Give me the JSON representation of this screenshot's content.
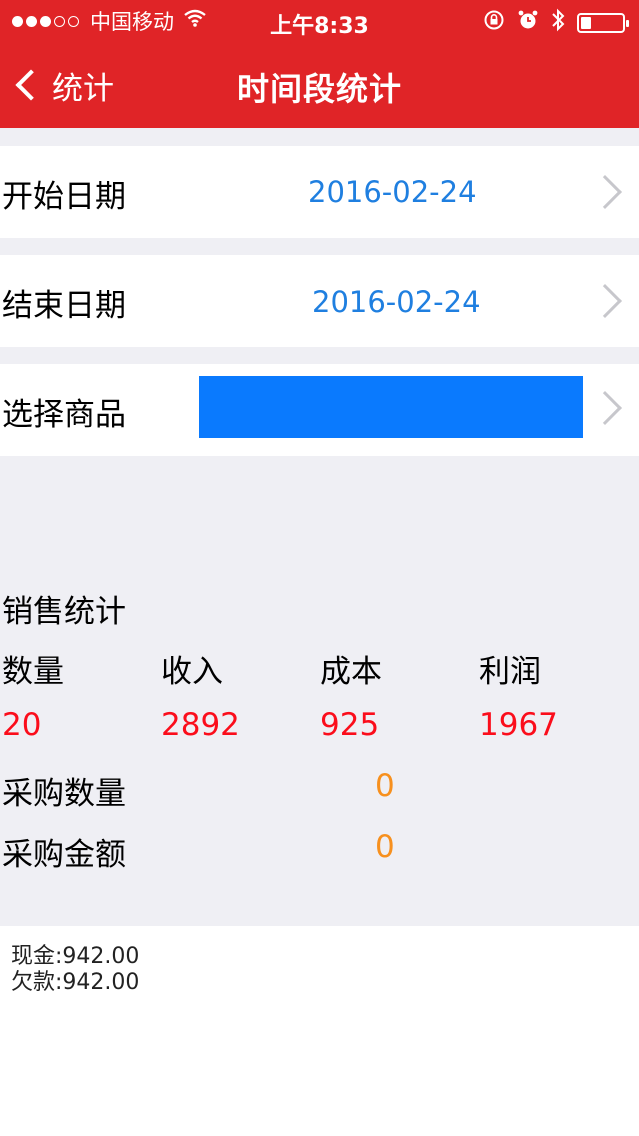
{
  "status_bar": {
    "carrier": "中国移动",
    "time": "上午8:33",
    "wifi_icon": "wifi-icon",
    "lock_icon": "rotation-lock-icon",
    "alarm_icon": "alarm-icon",
    "bluetooth_icon": "bluetooth-icon",
    "battery_level": 0.25
  },
  "nav": {
    "back_label": "统计",
    "title": "时间段统计"
  },
  "form": {
    "start": {
      "label": "开始日期",
      "value": "2016-02-24"
    },
    "end": {
      "label": "结束日期",
      "value": "2016-02-24"
    },
    "product": {
      "label": "选择商品",
      "value": ""
    }
  },
  "sales": {
    "title": "销售统计",
    "headers": [
      "数量",
      "收入",
      "成本",
      "利润"
    ],
    "values": [
      "20",
      "2892",
      "925",
      "1967"
    ]
  },
  "purchase": {
    "quantity_label": "采购数量",
    "quantity_value": "0",
    "amount_label": "采购金额",
    "amount_value": "0"
  },
  "summary": {
    "cash": "现金:942.00",
    "debt": "欠款:942.00"
  },
  "colors": {
    "header": "#e02427",
    "link_blue": "#1f7fe0",
    "value_red": "#fb0d1b",
    "value_orange": "#f7901e",
    "selection_blue": "#0a7afe"
  }
}
